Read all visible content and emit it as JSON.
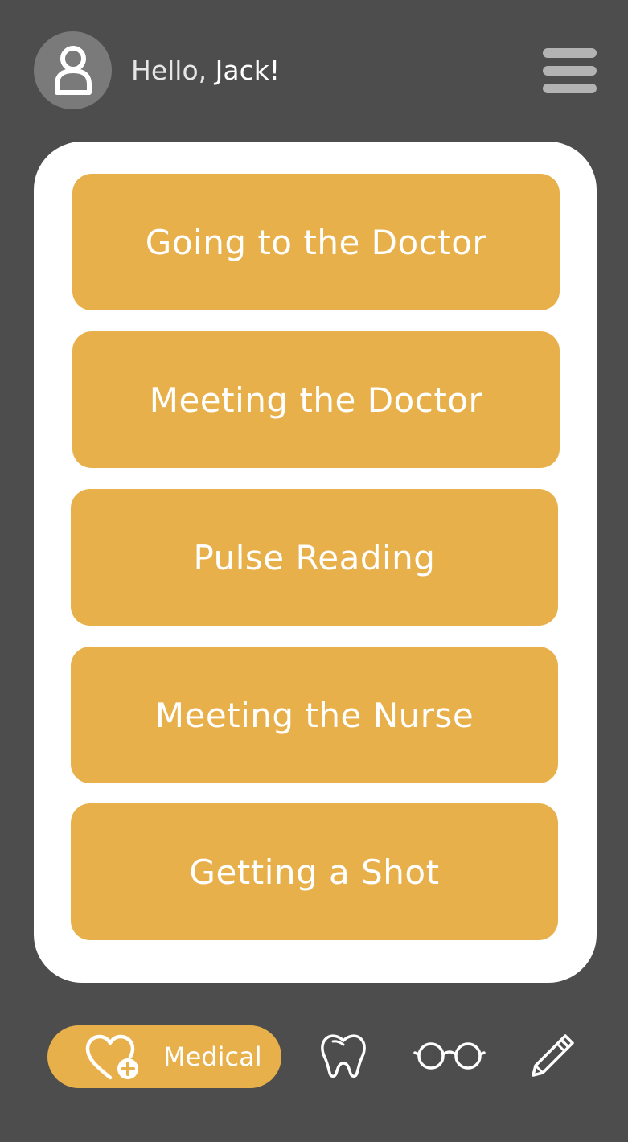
{
  "header": {
    "greeting_prefix": "Hello,",
    "user_name": "Jack!"
  },
  "topics": [
    "Going to the Doctor",
    "Meeting the Doctor",
    "Pulse Reading",
    "Meeting the Nurse",
    "Getting a Shot"
  ],
  "bottom_nav": {
    "active_label": "Medical",
    "items": [
      {
        "name": "medical",
        "icon": "heart-plus-icon"
      },
      {
        "name": "dental",
        "icon": "tooth-icon"
      },
      {
        "name": "vision",
        "icon": "glasses-icon"
      },
      {
        "name": "notes",
        "icon": "pencil-icon"
      }
    ]
  },
  "colors": {
    "background": "#4d4d4d",
    "accent": "#e8b04a",
    "card": "#ffffff",
    "avatar_bg": "#7a7a7a",
    "menu_bars": "#b3b3b3"
  }
}
